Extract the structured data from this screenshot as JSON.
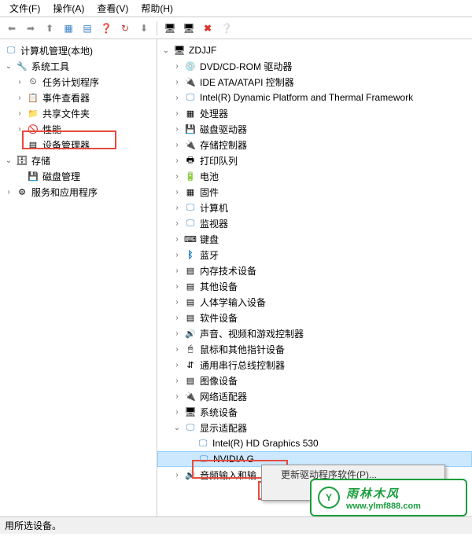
{
  "menubar": {
    "file": "文件(F)",
    "action": "操作(A)",
    "view": "查看(V)",
    "help": "帮助(H)"
  },
  "left_tree": {
    "root": "计算机管理(本地)",
    "system_tools": "系统工具",
    "task_scheduler": "任务计划程序",
    "event_viewer": "事件查看器",
    "shared_folders": "共享文件夹",
    "performance": "性能",
    "device_manager": "设备管理器",
    "storage": "存储",
    "disk_mgmt": "磁盘管理",
    "services": "服务和应用程序"
  },
  "right_tree": {
    "root": "ZDJJF",
    "dvd": "DVD/CD-ROM 驱动器",
    "ide": "IDE ATA/ATAPI 控制器",
    "intel_dptf": "Intel(R) Dynamic Platform and Thermal Framework",
    "cpu": "处理器",
    "disk_drives": "磁盘驱动器",
    "storage_ctrl": "存储控制器",
    "print_queue": "打印队列",
    "battery": "电池",
    "firmware": "固件",
    "computer": "计算机",
    "monitor": "监视器",
    "keyboard": "键盘",
    "bluetooth": "蓝牙",
    "memory_tech": "内存技术设备",
    "other": "其他设备",
    "hid": "人体学输入设备",
    "software": "软件设备",
    "sound": "声音、视频和游戏控制器",
    "mouse": "鼠标和其他指针设备",
    "usb": "通用串行总线控制器",
    "imaging": "图像设备",
    "network": "网络适配器",
    "system_devices": "系统设备",
    "display_adapters": "显示适配器",
    "intel_hd": "Intel(R) HD Graphics 530",
    "nvidia": "NVIDIA G",
    "audio": "音频输入和输"
  },
  "context_menu": {
    "update": "更新驱动程序软件(P)..."
  },
  "statusbar": {
    "text": "用所选设备。"
  },
  "watermark": {
    "title": "雨林木风",
    "url": "www.ylmf888.com"
  }
}
